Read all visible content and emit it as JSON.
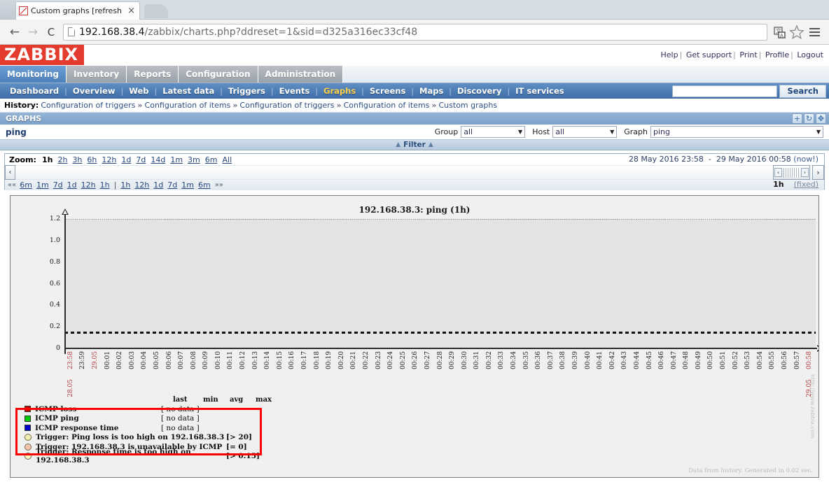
{
  "browser": {
    "tab_title": "Custom graphs [refresh",
    "tab_close": "×",
    "back_icon": "←",
    "forward_icon": "→",
    "reload_icon": "C",
    "url_host": "192.168.38.4",
    "url_path": "/zabbix/charts.php?ddreset=1&sid=d325a316ec33cf48"
  },
  "zabbix": {
    "logo": "ZABBIX",
    "user_links": [
      "Help",
      "Get support",
      "Print",
      "Profile",
      "Logout"
    ],
    "main_menu": [
      {
        "label": "Monitoring",
        "active": true
      },
      {
        "label": "Inventory",
        "active": false
      },
      {
        "label": "Reports",
        "active": false
      },
      {
        "label": "Configuration",
        "active": false
      },
      {
        "label": "Administration",
        "active": false
      }
    ],
    "sub_menu": [
      {
        "label": "Dashboard",
        "active": false
      },
      {
        "label": "Overview",
        "active": false
      },
      {
        "label": "Web",
        "active": false
      },
      {
        "label": "Latest data",
        "active": false
      },
      {
        "label": "Triggers",
        "active": false
      },
      {
        "label": "Events",
        "active": false
      },
      {
        "label": "Graphs",
        "active": true
      },
      {
        "label": "Screens",
        "active": false
      },
      {
        "label": "Maps",
        "active": false
      },
      {
        "label": "Discovery",
        "active": false
      },
      {
        "label": "IT services",
        "active": false
      }
    ],
    "search": {
      "value": "",
      "placeholder": "",
      "button_label": "Search"
    },
    "history": {
      "label": "History:",
      "items": [
        "Configuration of triggers",
        "Configuration of items",
        "Configuration of triggers",
        "Configuration of items",
        "Custom graphs"
      ],
      "separator": "»"
    }
  },
  "panel": {
    "title": "GRAPHS",
    "icons": [
      "plus-icon",
      "refresh-icon",
      "fullscreen-icon"
    ],
    "icon_glyphs": {
      "plus": "+",
      "refresh": "↻",
      "fullscreen": "✥"
    },
    "graph_name": "ping",
    "filter_strip": "Filter",
    "filter": {
      "group_label": "Group",
      "group_value": "all",
      "host_label": "Host",
      "host_value": "all",
      "graph_label": "Graph",
      "graph_value": "ping"
    }
  },
  "timebar": {
    "zoom_label": "Zoom:",
    "zoom_options": [
      {
        "label": "1h",
        "current": true
      },
      {
        "label": "2h",
        "current": false
      },
      {
        "label": "3h",
        "current": false
      },
      {
        "label": "6h",
        "current": false
      },
      {
        "label": "12h",
        "current": false
      },
      {
        "label": "1d",
        "current": false
      },
      {
        "label": "7d",
        "current": false
      },
      {
        "label": "14d",
        "current": false
      },
      {
        "label": "1m",
        "current": false
      },
      {
        "label": "3m",
        "current": false
      },
      {
        "label": "6m",
        "current": false
      },
      {
        "label": "All",
        "current": false
      }
    ],
    "range_from": "28 May 2016 23:58",
    "range_dash": "-",
    "range_to": "29 May 2016 00:58",
    "now_label": "(now!)",
    "nav_prev_arrows": "««",
    "nav_next_arrows": "»»",
    "nav_left": [
      "6m",
      "1m",
      "7d",
      "1d",
      "12h",
      "1h"
    ],
    "nav_pipe": "|",
    "nav_right": [
      "1h",
      "12h",
      "1d",
      "7d",
      "1m",
      "6m"
    ],
    "period_label": "1h",
    "fixed_label": "(fixed)",
    "slider_left_glyph": "‹",
    "slider_right_glyph": "›",
    "handle_left_glyph": "‹",
    "handle_right_glyph": "›"
  },
  "chart_data": {
    "type": "line",
    "title": "192.168.38.3: ping (1h)",
    "xlabel": "",
    "ylabel": "",
    "ylim": [
      0,
      1.2
    ],
    "yticks": [
      "1.2",
      "1.0",
      "0.8",
      "0.6",
      "0.4",
      "0.2",
      "0"
    ],
    "grid": true,
    "legend_position": "bottom-left",
    "x_start": "28.05 23:58",
    "x_end": "29.05 00:58",
    "xticks": [
      {
        "time": "23:58",
        "date": "28.05",
        "highlight": true
      },
      {
        "time": "23:59",
        "date": "",
        "highlight": false
      },
      {
        "time": "29.05",
        "date": "",
        "highlight": true
      },
      {
        "time": "00:01",
        "date": "",
        "highlight": false
      },
      {
        "time": "00:02",
        "date": "",
        "highlight": false
      },
      {
        "time": "00:03",
        "date": "",
        "highlight": false
      },
      {
        "time": "00:04",
        "date": "",
        "highlight": false
      },
      {
        "time": "00:05",
        "date": "",
        "highlight": false
      },
      {
        "time": "00:06",
        "date": "",
        "highlight": false
      },
      {
        "time": "00:07",
        "date": "",
        "highlight": false
      },
      {
        "time": "00:08",
        "date": "",
        "highlight": false
      },
      {
        "time": "00:09",
        "date": "",
        "highlight": false
      },
      {
        "time": "00:10",
        "date": "",
        "highlight": false
      },
      {
        "time": "00:11",
        "date": "",
        "highlight": false
      },
      {
        "time": "00:12",
        "date": "",
        "highlight": false
      },
      {
        "time": "00:13",
        "date": "",
        "highlight": false
      },
      {
        "time": "00:14",
        "date": "",
        "highlight": false
      },
      {
        "time": "00:15",
        "date": "",
        "highlight": false
      },
      {
        "time": "00:16",
        "date": "",
        "highlight": false
      },
      {
        "time": "00:17",
        "date": "",
        "highlight": false
      },
      {
        "time": "00:18",
        "date": "",
        "highlight": false
      },
      {
        "time": "00:19",
        "date": "",
        "highlight": false
      },
      {
        "time": "00:20",
        "date": "",
        "highlight": false
      },
      {
        "time": "00:21",
        "date": "",
        "highlight": false
      },
      {
        "time": "00:22",
        "date": "",
        "highlight": false
      },
      {
        "time": "00:23",
        "date": "",
        "highlight": false
      },
      {
        "time": "00:24",
        "date": "",
        "highlight": false
      },
      {
        "time": "00:25",
        "date": "",
        "highlight": false
      },
      {
        "time": "00:26",
        "date": "",
        "highlight": false
      },
      {
        "time": "00:27",
        "date": "",
        "highlight": false
      },
      {
        "time": "00:28",
        "date": "",
        "highlight": false
      },
      {
        "time": "00:29",
        "date": "",
        "highlight": false
      },
      {
        "time": "00:30",
        "date": "",
        "highlight": false
      },
      {
        "time": "00:31",
        "date": "",
        "highlight": false
      },
      {
        "time": "00:32",
        "date": "",
        "highlight": false
      },
      {
        "time": "00:33",
        "date": "",
        "highlight": false
      },
      {
        "time": "00:34",
        "date": "",
        "highlight": false
      },
      {
        "time": "00:35",
        "date": "",
        "highlight": false
      },
      {
        "time": "00:36",
        "date": "",
        "highlight": false
      },
      {
        "time": "00:37",
        "date": "",
        "highlight": false
      },
      {
        "time": "00:38",
        "date": "",
        "highlight": false
      },
      {
        "time": "00:39",
        "date": "",
        "highlight": false
      },
      {
        "time": "00:40",
        "date": "",
        "highlight": false
      },
      {
        "time": "00:41",
        "date": "",
        "highlight": false
      },
      {
        "time": "00:42",
        "date": "",
        "highlight": false
      },
      {
        "time": "00:43",
        "date": "",
        "highlight": false
      },
      {
        "time": "00:44",
        "date": "",
        "highlight": false
      },
      {
        "time": "00:45",
        "date": "",
        "highlight": false
      },
      {
        "time": "00:46",
        "date": "",
        "highlight": false
      },
      {
        "time": "00:47",
        "date": "",
        "highlight": false
      },
      {
        "time": "00:48",
        "date": "",
        "highlight": false
      },
      {
        "time": "00:49",
        "date": "",
        "highlight": false
      },
      {
        "time": "00:50",
        "date": "",
        "highlight": false
      },
      {
        "time": "00:51",
        "date": "",
        "highlight": false
      },
      {
        "time": "00:52",
        "date": "",
        "highlight": false
      },
      {
        "time": "00:53",
        "date": "",
        "highlight": false
      },
      {
        "time": "00:54",
        "date": "",
        "highlight": false
      },
      {
        "time": "00:55",
        "date": "",
        "highlight": false
      },
      {
        "time": "00:56",
        "date": "",
        "highlight": false
      },
      {
        "time": "00:57",
        "date": "",
        "highlight": false
      },
      {
        "time": "00:58",
        "date": "29.05",
        "highlight": true
      }
    ],
    "series": [
      {
        "name": "ICMP loss",
        "color": "#cc0000",
        "values": [],
        "status": "[ no data ]"
      },
      {
        "name": "ICMP ping",
        "color": "#00cc00",
        "values": [],
        "status": "[ no data ]"
      },
      {
        "name": "ICMP response time",
        "color": "#0000cc",
        "values": [],
        "status": "[ no data ]"
      }
    ],
    "threshold_lines": [
      {
        "value": 0.15,
        "color": "#111111",
        "style": "dashed"
      }
    ],
    "watermark": "http://www.zabbix.com"
  },
  "legend": {
    "columns": [
      "last",
      "min",
      "avg",
      "max"
    ],
    "rows": [
      {
        "color": "#cc0000",
        "name": "ICMP loss",
        "value": "[ no data ]"
      },
      {
        "color": "#00cc00",
        "name": "ICMP ping",
        "value": "[ no data ]"
      },
      {
        "color": "#0000cc",
        "name": "ICMP response time",
        "value": "[ no data ]"
      }
    ],
    "triggers": [
      {
        "color": "#f2f0b0",
        "text": "Trigger: Ping loss is too high on 192.168.38.3",
        "condition": "[> 20]"
      },
      {
        "color": "#f5c2ae",
        "text": "Trigger: 192.168.38.3 is unavailable by ICMP",
        "condition": "[= 0]"
      },
      {
        "color": "#f7f3c4",
        "text": "Trigger: Response time is too high on 192.168.38.3",
        "condition": "[> 0.15]"
      }
    ]
  },
  "footer": {
    "generated_note": "Data from history. Generated in 0.02 sec."
  }
}
